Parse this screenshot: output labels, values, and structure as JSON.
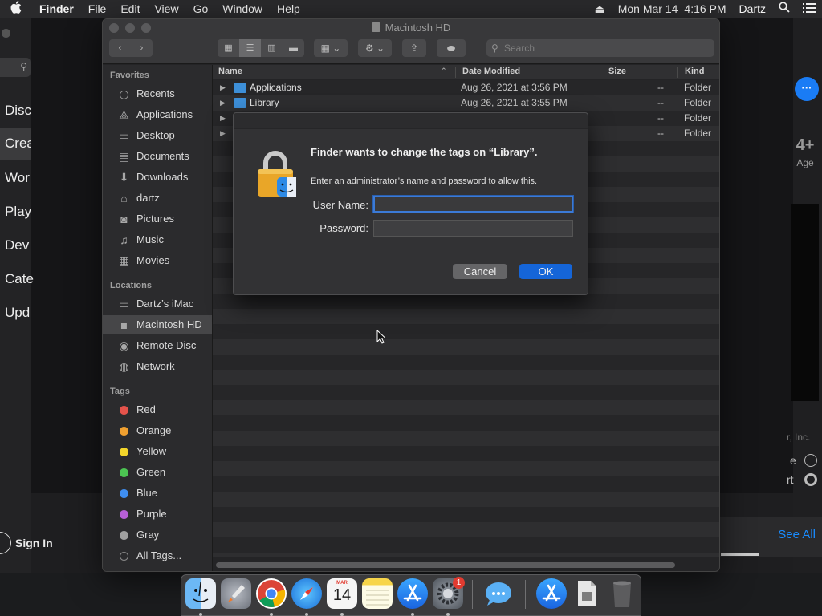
{
  "menubar": {
    "apple_icon": "apple-logo-icon",
    "app_name": "Finder",
    "menus": [
      "File",
      "Edit",
      "View",
      "Go",
      "Window",
      "Help"
    ],
    "date": "Mon Mar 14",
    "time": "4:16 PM",
    "user": "Dartz"
  },
  "background_app": {
    "nav_items": [
      "Disc",
      "Crea",
      "Wor",
      "Play",
      "Dev",
      "Cate",
      "Upd"
    ],
    "age_rating": "4+",
    "age_label": "Age",
    "company_fragment": "r, Inc.",
    "side_fragment_1": "e",
    "side_fragment_2": "rt",
    "see_all": "See All",
    "sign_in": "Sign In"
  },
  "finder": {
    "window_title": "Macintosh HD",
    "search_placeholder": "Search",
    "sidebar": {
      "favorites_header": "Favorites",
      "favorites": [
        {
          "label": "Recents",
          "icon": "clock-icon"
        },
        {
          "label": "Applications",
          "icon": "applications-icon"
        },
        {
          "label": "Desktop",
          "icon": "desktop-icon"
        },
        {
          "label": "Documents",
          "icon": "document-icon"
        },
        {
          "label": "Downloads",
          "icon": "download-icon"
        },
        {
          "label": "dartz",
          "icon": "home-icon"
        },
        {
          "label": "Pictures",
          "icon": "camera-icon"
        },
        {
          "label": "Music",
          "icon": "music-note-icon"
        },
        {
          "label": "Movies",
          "icon": "film-icon"
        }
      ],
      "locations_header": "Locations",
      "locations": [
        {
          "label": "Dartz’s iMac",
          "icon": "imac-icon"
        },
        {
          "label": "Macintosh HD",
          "icon": "hard-drive-icon"
        },
        {
          "label": "Remote Disc",
          "icon": "disc-icon"
        },
        {
          "label": "Network",
          "icon": "globe-icon"
        }
      ],
      "tags_header": "Tags",
      "tags": [
        {
          "label": "Red",
          "color": "#e5534b"
        },
        {
          "label": "Orange",
          "color": "#f0a030"
        },
        {
          "label": "Yellow",
          "color": "#f2d52b"
        },
        {
          "label": "Green",
          "color": "#4cc552"
        },
        {
          "label": "Blue",
          "color": "#3f8ef0"
        },
        {
          "label": "Purple",
          "color": "#b65fd6"
        },
        {
          "label": "Gray",
          "color": "#a0a0a0"
        }
      ],
      "all_tags": "All Tags..."
    },
    "columns": {
      "name": "Name",
      "date": "Date Modified",
      "size": "Size",
      "kind": "Kind"
    },
    "rows": [
      {
        "name": "Applications",
        "date": "Aug 26, 2021 at 3:56 PM",
        "size": "--",
        "kind": "Folder"
      },
      {
        "name": "Library",
        "date": "Aug 26, 2021 at 3:55 PM",
        "size": "--",
        "kind": "Folder"
      },
      {
        "name": "",
        "date": "",
        "size": "--",
        "kind": "Folder"
      },
      {
        "name": "",
        "date": "",
        "size": "--",
        "kind": "Folder"
      }
    ]
  },
  "dialog": {
    "title": "Finder wants to change the tags on “Library”.",
    "message": "Enter an administrator’s name and password to allow this.",
    "username_label": "User Name:",
    "password_label": "Password:",
    "username_value": "",
    "password_value": "",
    "cancel_label": "Cancel",
    "ok_label": "OK"
  },
  "dock": {
    "calendar_month": "MAR",
    "calendar_day": "14",
    "badge_count": "1",
    "apps": [
      "finder-icon",
      "launchpad-icon",
      "chrome-icon",
      "safari-icon",
      "calendar-icon",
      "notes-icon",
      "app-store-icon",
      "system-preferences-icon",
      "messages-icon",
      "app-store-folder-icon",
      "document-icon",
      "trash-icon"
    ]
  }
}
